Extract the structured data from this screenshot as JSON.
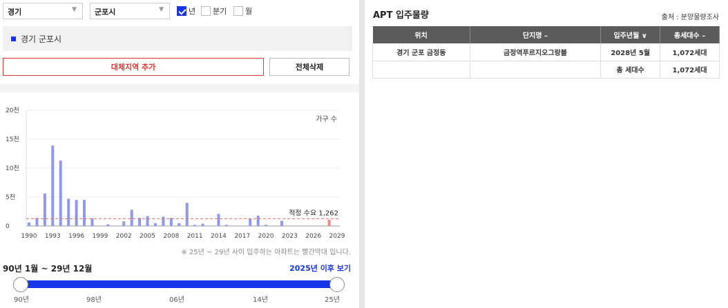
{
  "filters": {
    "province": "경기",
    "city": "군포시",
    "period_options": [
      {
        "label": "년",
        "checked": true
      },
      {
        "label": "분기",
        "checked": false
      },
      {
        "label": "월",
        "checked": false
      }
    ]
  },
  "region_tag": "경기 군포시",
  "buttons": {
    "add_region": "대체지역 추가",
    "delete_all": "전체삭제"
  },
  "chart_data": {
    "type": "bar",
    "legend": "가구 수",
    "y_ticks": [
      "20천",
      "15천",
      "10천",
      "5천",
      "0"
    ],
    "ylim": [
      0,
      20000
    ],
    "x_tick_labels": [
      "1990",
      "1993",
      "1996",
      "1999",
      "2002",
      "2005",
      "2008",
      "2011",
      "2014",
      "2017",
      "2020",
      "2023",
      "2026",
      "2029"
    ],
    "x": [
      1990,
      1991,
      1992,
      1993,
      1994,
      1995,
      1996,
      1997,
      1998,
      1999,
      2000,
      2001,
      2002,
      2003,
      2004,
      2005,
      2006,
      2007,
      2008,
      2009,
      2010,
      2011,
      2012,
      2013,
      2014,
      2015,
      2016,
      2017,
      2018,
      2019,
      2020,
      2021,
      2022,
      2023,
      2024,
      2025,
      2026,
      2027,
      2028,
      2029
    ],
    "values": [
      600,
      1400,
      5600,
      13900,
      11300,
      4700,
      4500,
      4500,
      1300,
      0,
      300,
      0,
      800,
      2800,
      1400,
      1700,
      500,
      1600,
      1400,
      500,
      4000,
      200,
      400,
      0,
      2100,
      200,
      0,
      0,
      1300,
      1800,
      200,
      0,
      900,
      0,
      0,
      0,
      0,
      0,
      1072,
      0
    ],
    "threshold": {
      "label": "적정 수요 1,262",
      "value": 1262
    },
    "highlight_from": 2025
  },
  "chart_note": "※ 25년 ~ 29년 사이 입주하는 아파트는 빨간막대 입니다.",
  "range": {
    "label": "90년 1월 ~ 29년 12월",
    "link": "2025년 이후 보기",
    "ticks": [
      "90년",
      "98년",
      "06년",
      "14년",
      "25년"
    ]
  },
  "table": {
    "title": "APT 입주물량",
    "source": "출처 : 분양물량조사",
    "headers": [
      "위치",
      "단지명 –",
      "입주년월 ∨",
      "총세대수 –"
    ],
    "rows": [
      [
        "경기 군포 금정동",
        "금정역푸르지오그랑블",
        "2028년 5월",
        "1,072세대"
      ],
      [
        "",
        "",
        "총 세대수",
        "1,072세대"
      ]
    ]
  },
  "colors": {
    "accent": "#1734e8",
    "bar": "#8f97ee",
    "highlight_bar": "#f08a80",
    "threshold": "#ef6b5f",
    "add_button": "#e8332f"
  }
}
